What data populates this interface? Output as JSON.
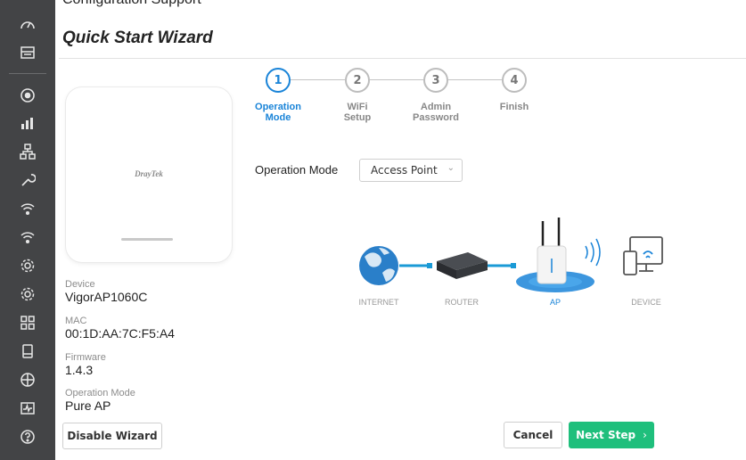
{
  "caption": "Configuration Support",
  "page": {
    "title": "Quick Start Wizard"
  },
  "sidebar": {
    "icons": [
      "dashboard-icon",
      "wizard-icon",
      "online-status-icon",
      "bar-chart-icon",
      "network-icon",
      "tools-icon",
      "wifi-24g-icon",
      "wifi-5g-icon",
      "gear-icon",
      "settings-icon",
      "apps-icon",
      "device-icon",
      "shield-icon",
      "diagnostics-icon",
      "help-icon"
    ]
  },
  "device": {
    "brand": "DrayTek",
    "device_label": "Device",
    "device_value": "VigorAP1060C",
    "mac_label": "MAC",
    "mac_value": "00:1D:AA:7C:F5:A4",
    "firmware_label": "Firmware",
    "firmware_value": "1.4.3",
    "opmode_label": "Operation Mode",
    "opmode_value": "Pure AP",
    "disable_label": "Disable Wizard"
  },
  "steps": [
    {
      "num": "1",
      "line1": "Operation",
      "line2": "Mode",
      "active": true
    },
    {
      "num": "2",
      "line1": "WiFi",
      "line2": "Setup",
      "active": false
    },
    {
      "num": "3",
      "line1": "Admin",
      "line2": "Password",
      "active": false
    },
    {
      "num": "4",
      "line1": "Finish",
      "line2": "",
      "active": false
    }
  ],
  "operation": {
    "label": "Operation Mode",
    "selected": "Access Point"
  },
  "topology": {
    "internet": "INTERNET",
    "router": "ROUTER",
    "ap": "AP",
    "device": "DEVICE"
  },
  "buttons": {
    "cancel": "Cancel",
    "next": "Next Step"
  },
  "colors": {
    "accent": "#1a84d8",
    "primary_button": "#1fbf7c",
    "sidebar": "#434446"
  }
}
